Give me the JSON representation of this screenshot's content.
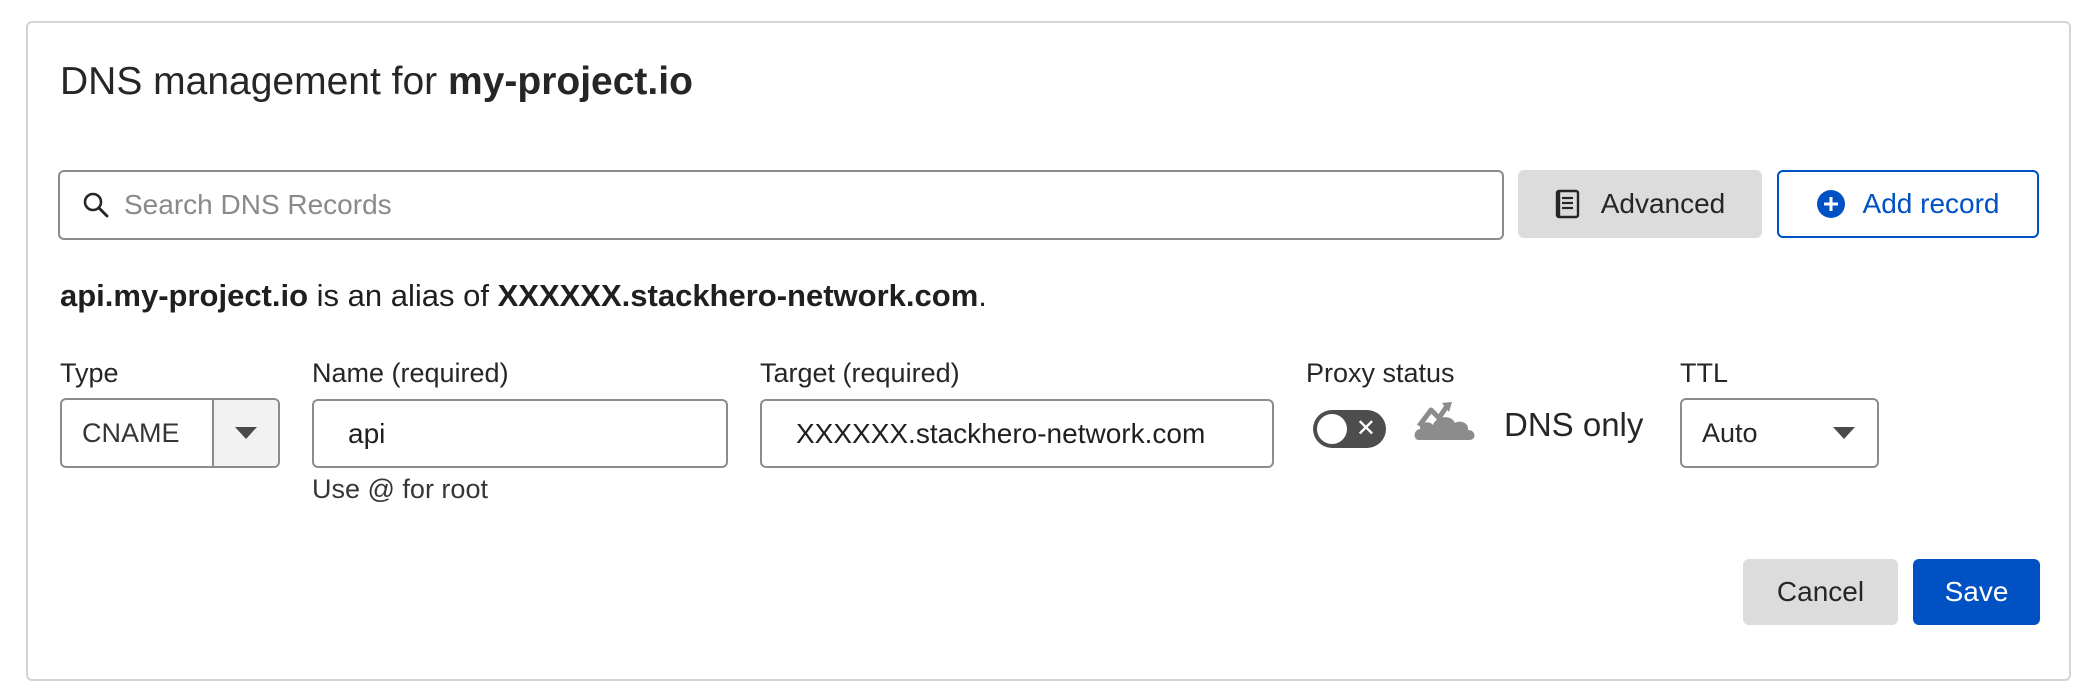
{
  "header": {
    "title_prefix": "DNS management for ",
    "domain": "my-project.io"
  },
  "search": {
    "placeholder": "Search DNS Records",
    "value": "",
    "icon": "search-icon"
  },
  "toolbar": {
    "advanced_label": "Advanced",
    "advanced_icon": "document-icon",
    "add_record_label": "Add record",
    "add_record_icon": "plus-circle-icon"
  },
  "alias_message": {
    "name": "api.my-project.io",
    "middle": " is an alias of ",
    "target": "XXXXXX.stackhero-network.com",
    "suffix": "."
  },
  "form": {
    "type": {
      "label": "Type",
      "value": "CNAME"
    },
    "name": {
      "label": "Name (required)",
      "value": "api",
      "hint": "Use @ for root"
    },
    "target": {
      "label": "Target (required)",
      "value": "XXXXXX.stackhero-network.com"
    },
    "proxy": {
      "label": "Proxy status",
      "enabled": false,
      "toggle_off_glyph": "✕",
      "status_text": "DNS only",
      "icon": "cloud-bypass-icon"
    },
    "ttl": {
      "label": "TTL",
      "value": "Auto"
    }
  },
  "actions": {
    "cancel_label": "Cancel",
    "save_label": "Save"
  },
  "colors": {
    "accent": "#0051c3",
    "secondary_button": "#dcdcdc",
    "toggle_off": "#4d4d4d",
    "cloud_gray": "#8c8c8c"
  }
}
